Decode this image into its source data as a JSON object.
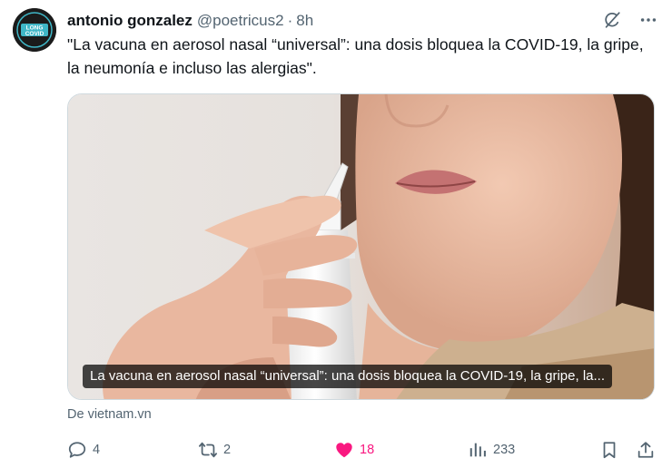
{
  "author": {
    "display_name": "antonio gonzalez",
    "handle": "@poetricus2",
    "separator": "·",
    "time": "8h",
    "avatar_text": [
      "LONG",
      "COVID"
    ]
  },
  "tweet": {
    "text": "\"La vacuna en aerosol nasal “universal”: una dosis bloquea la COVID-19, la gripe, la neumonía e incluso las alergias\"."
  },
  "card": {
    "caption": "La vacuna en aerosol nasal “universal”: una dosis bloquea la COVID-19, la gripe, la...",
    "source": "De vietnam.vn"
  },
  "metrics": {
    "replies": "4",
    "retweets": "2",
    "likes": "18",
    "views": "233"
  },
  "colors": {
    "like_active": "#f91880",
    "muted": "#536471",
    "text": "#0f1419"
  },
  "icons": [
    "grok-icon",
    "more-icon",
    "reply-icon",
    "retweet-icon",
    "heart-icon",
    "views-icon",
    "bookmark-icon",
    "share-icon"
  ]
}
